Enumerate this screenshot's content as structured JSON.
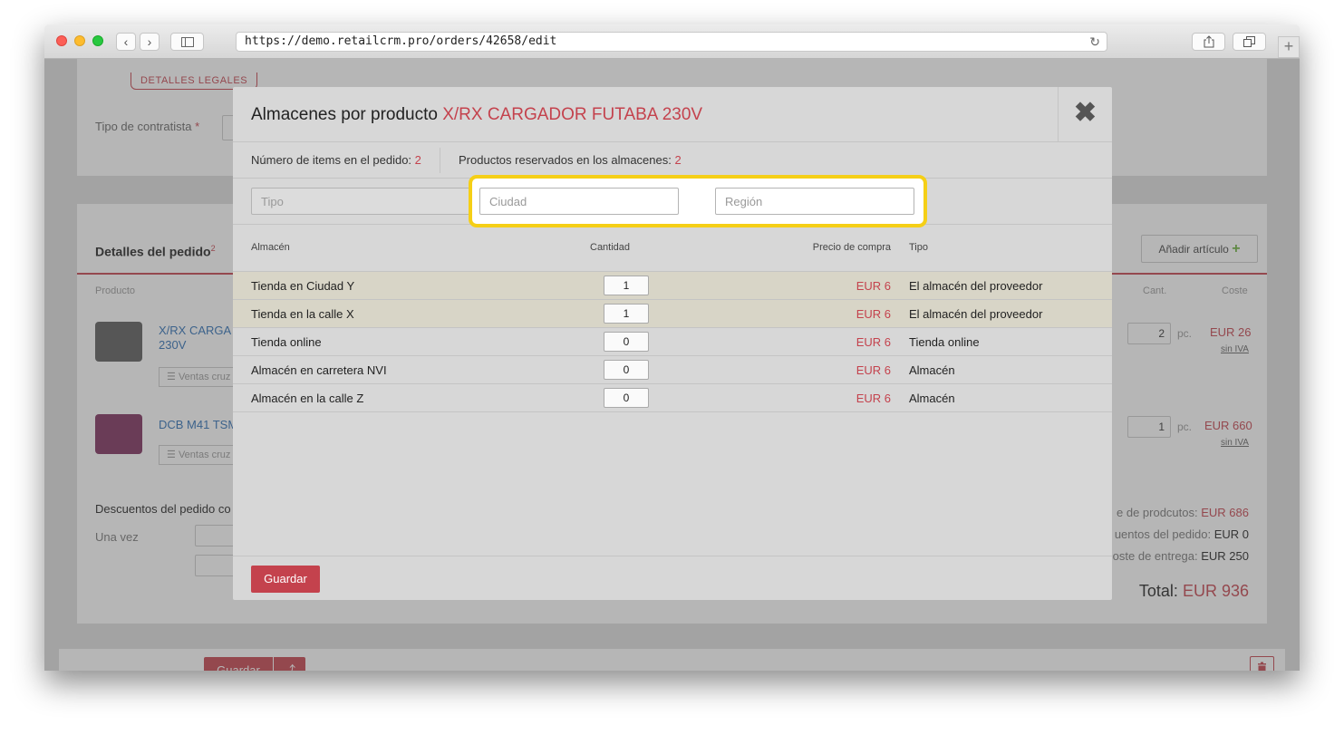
{
  "browser": {
    "url": "https://demo.retailcrm.pro/orders/42658/edit",
    "back_glyph": "‹",
    "forward_glyph": "›",
    "newtab_glyph": "+"
  },
  "page": {
    "legal_tag": "DETALLES LEGALES",
    "contractor_label": "Tipo de contratista",
    "required_mark": "*",
    "order_details_title": "Detalles del pedido",
    "order_details_sup": "2",
    "add_item_label": "Añadir artículo",
    "col_product": "Producto",
    "col_qty": "Cant.",
    "col_cost": "Coste",
    "items": [
      {
        "name": "X/RX CARGA\n230V",
        "cross_sell": "Ventas cruz",
        "qty": "2",
        "unit": "pc.",
        "cost": "EUR 26",
        "vat": "sin IVA"
      },
      {
        "name": "DCB M41 TSM",
        "cross_sell": "Ventas cruz",
        "qty": "1",
        "unit": "pc.",
        "cost": "EUR 660",
        "vat": "sin IVA"
      }
    ],
    "discounts_label": "Descuentos del pedido co",
    "once_label": "Una vez",
    "product_cost_label": "e de prodcutos:",
    "product_cost_value": "EUR 686",
    "order_discount_label": "uentos del pedido:",
    "order_discount_value": "EUR 0",
    "delivery_label": "oste de entrega:",
    "delivery_value": "EUR 250",
    "total_label": "Total:",
    "total_value": "EUR 936",
    "save_label": "Guardar",
    "save_arrow": "⤴"
  },
  "modal": {
    "title": "Almacenes por producto",
    "product": "X/RX CARGADOR FUTABA 230V",
    "items_in_order_label": "Número de items en el pedido:",
    "items_in_order_value": "2",
    "reserved_label": "Productos reservados en los almacenes:",
    "reserved_value": "2",
    "filter_type_placeholder": "Tipo",
    "filter_city_placeholder": "Ciudad",
    "filter_region_placeholder": "Región",
    "columns": {
      "warehouse": "Almacén",
      "quantity": "Cantidad",
      "price": "Precio de compra",
      "type": "Tipo"
    },
    "rows": [
      {
        "warehouse": "Tienda en Ciudad Y",
        "quantity": "1",
        "price": "EUR 6",
        "type": "El almacén del proveedor",
        "selected": true
      },
      {
        "warehouse": "Tienda en la calle X",
        "quantity": "1",
        "price": "EUR 6",
        "type": "El almacén del proveedor",
        "selected": true
      },
      {
        "warehouse": "Tienda online",
        "quantity": "0",
        "price": "EUR 6",
        "type": "Tienda online",
        "selected": false
      },
      {
        "warehouse": "Almacén en carretera NVI",
        "quantity": "0",
        "price": "EUR 6",
        "type": "Almacén",
        "selected": false
      },
      {
        "warehouse": "Almacén en la calle Z",
        "quantity": "0",
        "price": "EUR 6",
        "type": "Almacén",
        "selected": false
      }
    ],
    "save_label": "Guardar",
    "close_glyph": "✖"
  },
  "colors": {
    "accent": "#c4424d",
    "highlight": "#f5cf16",
    "link": "#2d6fb5"
  }
}
